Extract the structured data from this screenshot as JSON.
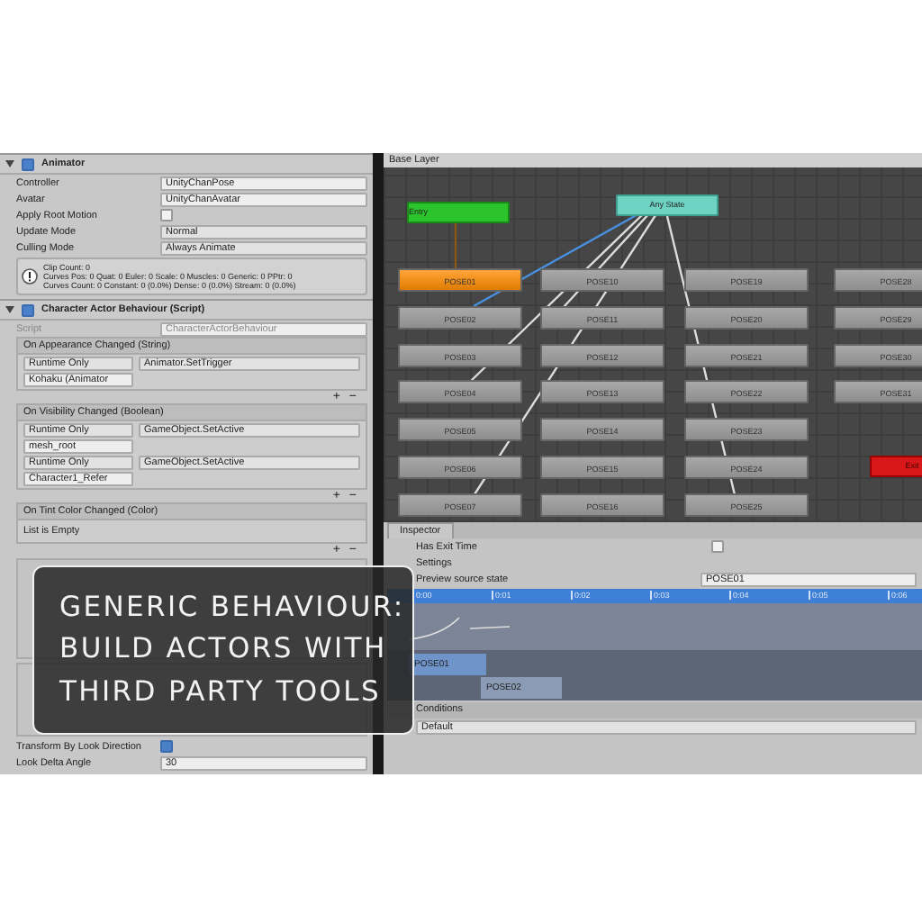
{
  "animator": {
    "title": "Animator",
    "enabled": true,
    "fields": [
      {
        "label": "Controller",
        "kind": "object",
        "value": "UnityChanPose"
      },
      {
        "label": "Avatar",
        "kind": "object",
        "value": "UnityChanAvatar"
      },
      {
        "label": "Apply Root Motion",
        "kind": "checkbox",
        "checked": false
      },
      {
        "label": "Update Mode",
        "kind": "dropdown",
        "value": "Normal"
      },
      {
        "label": "Culling Mode",
        "kind": "dropdown",
        "value": "Always Animate"
      }
    ],
    "info": [
      "Clip Count: 0",
      "Curves Pos: 0 Quat: 0 Euler: 0 Scale: 0 Muscles: 0 Generic: 0 PPtr: 0",
      "Curves Count: 0 Constant: 0 (0.0%) Dense: 0 (0.0%) Stream: 0 (0.0%)"
    ]
  },
  "behaviour": {
    "title": "Character Actor Behaviour (Script)",
    "enabled": true,
    "script_label": "Script",
    "script": "CharacterActorBehaviour",
    "events": [
      {
        "title": "On Appearance Changed (String)",
        "entries": [
          {
            "mode": "Runtime Only",
            "function": "Animator.SetTrigger",
            "target": "Kohaku (Animator"
          }
        ],
        "add": "+",
        "remove": "−"
      },
      {
        "title": "On Visibility Changed (Boolean)",
        "entries": [
          {
            "mode": "Runtime Only",
            "function": "GameObject.SetActive",
            "target": "mesh_root"
          },
          {
            "mode": "Runtime Only",
            "function": "GameObject.SetActive",
            "target": "Character1_Refer"
          }
        ],
        "add": "+",
        "remove": "−"
      },
      {
        "title": "On Tint Color Changed (Color)",
        "empty": "List is Empty",
        "add": "+",
        "remove": "−"
      }
    ],
    "fields": [
      {
        "label": "Transform By Look Direction",
        "kind": "checkbox",
        "checked": true
      },
      {
        "label": "Look Delta Angle",
        "kind": "text",
        "value": "30"
      }
    ]
  },
  "graph": {
    "breadcrumb": "Base Layer",
    "special": [
      {
        "label": "Entry",
        "kind": "entry"
      },
      {
        "label": "Any State",
        "kind": "any"
      },
      {
        "label": "Exit",
        "kind": "exit"
      }
    ],
    "columns": [
      [
        {
          "label": "POSE01",
          "default": true
        },
        {
          "label": "POSE02",
          "default": false
        },
        {
          "label": "POSE03",
          "default": false
        },
        {
          "label": "POSE04",
          "default": false
        },
        {
          "label": "POSE05",
          "default": false
        },
        {
          "label": "POSE06",
          "default": false
        },
        {
          "label": "POSE07",
          "default": false
        }
      ],
      [
        {
          "label": "POSE10",
          "default": false
        },
        {
          "label": "POSE11",
          "default": false
        },
        {
          "label": "POSE12",
          "default": false
        },
        {
          "label": "POSE13",
          "default": false
        },
        {
          "label": "POSE14",
          "default": false
        },
        {
          "label": "POSE15",
          "default": false
        },
        {
          "label": "POSE16",
          "default": false
        }
      ],
      [
        {
          "label": "POSE19",
          "default": false
        },
        {
          "label": "POSE20",
          "default": false
        },
        {
          "label": "POSE21",
          "default": false
        },
        {
          "label": "POSE22",
          "default": false
        },
        {
          "label": "POSE23",
          "default": false
        },
        {
          "label": "POSE24",
          "default": false
        },
        {
          "label": "POSE25",
          "default": false
        }
      ],
      [
        {
          "label": "POSE28",
          "default": false
        },
        {
          "label": "POSE29",
          "default": false
        },
        {
          "label": "POSE30",
          "default": false
        },
        {
          "label": "POSE31",
          "default": false
        }
      ]
    ]
  },
  "inspector": {
    "tab": "Inspector",
    "has_exit_time": {
      "label": "Has Exit Time",
      "checked": false
    },
    "settings": "Settings",
    "preview": {
      "label": "Preview source state",
      "value": "POSE01"
    },
    "ticks": [
      "0:00",
      "0:01",
      "0:02",
      "0:03",
      "0:04",
      "0:05",
      "0:06"
    ],
    "clips": [
      "POSE01",
      "POSE02"
    ],
    "conditions": {
      "label": "Conditions",
      "value": "Default"
    }
  },
  "caption": [
    "GENERIC BEHAVIOUR:",
    "BUILD ACTORS WITH",
    "THIRD PARTY TOOLS"
  ]
}
